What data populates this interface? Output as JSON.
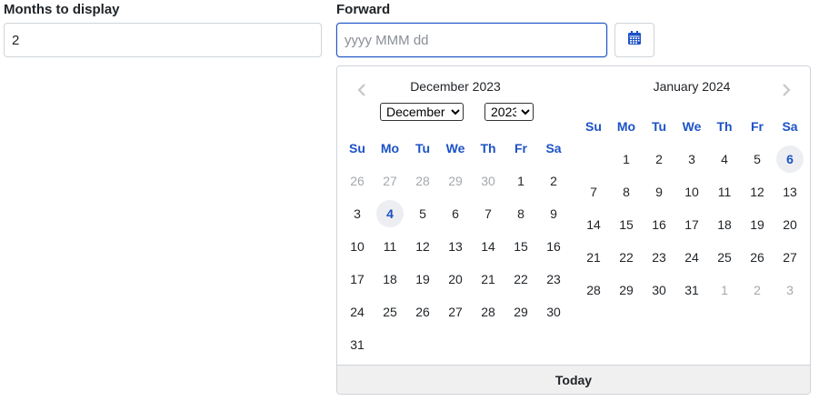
{
  "months_field": {
    "label": "Months to display",
    "value": "2"
  },
  "forward_field": {
    "label": "Forward",
    "placeholder": "yyyy MMM dd",
    "value": ""
  },
  "calendar_button": {
    "icon": "calendar-icon"
  },
  "colors": {
    "accent": "#1c52c7",
    "muted": "#a5a9ad",
    "border": "#ced4da"
  },
  "datepicker": {
    "weekdays": [
      "Su",
      "Mo",
      "Tu",
      "We",
      "Th",
      "Fr",
      "Sa"
    ],
    "nav": {
      "prev_icon": "chevron-left-icon",
      "next_icon": "chevron-right-icon"
    },
    "months": [
      {
        "title": "December 2023",
        "selected_month": "December",
        "selected_year": "2023",
        "weeks": [
          [
            "26",
            "27",
            "28",
            "29",
            "30",
            "1",
            "2"
          ],
          [
            "3",
            "4",
            "5",
            "6",
            "7",
            "8",
            "9"
          ],
          [
            "10",
            "11",
            "12",
            "13",
            "14",
            "15",
            "16"
          ],
          [
            "17",
            "18",
            "19",
            "20",
            "21",
            "22",
            "23"
          ],
          [
            "24",
            "25",
            "26",
            "27",
            "28",
            "29",
            "30"
          ],
          [
            "31"
          ]
        ],
        "other_month_days": [
          "0-0",
          "0-1",
          "0-2",
          "0-3",
          "0-4"
        ],
        "highlighted_days": [
          "1-1"
        ]
      },
      {
        "title": "January 2024",
        "weeks": [
          [
            "",
            "1",
            "2",
            "3",
            "4",
            "5",
            "6"
          ],
          [
            "7",
            "8",
            "9",
            "10",
            "11",
            "12",
            "13"
          ],
          [
            "14",
            "15",
            "16",
            "17",
            "18",
            "19",
            "20"
          ],
          [
            "21",
            "22",
            "23",
            "24",
            "25",
            "26",
            "27"
          ],
          [
            "28",
            "29",
            "30",
            "31",
            "1",
            "2",
            "3"
          ]
        ],
        "other_month_days": [
          "4-4",
          "4-5",
          "4-6"
        ],
        "highlighted_days": [
          "0-6"
        ]
      }
    ],
    "today_label": "Today"
  }
}
